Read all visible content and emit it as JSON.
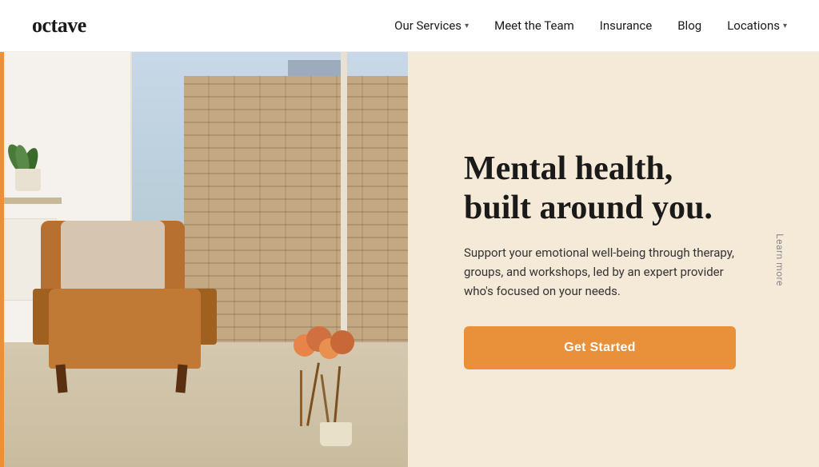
{
  "header": {
    "logo": "octave",
    "nav": {
      "services_label": "Our Services",
      "team_label": "Meet the Team",
      "insurance_label": "Insurance",
      "blog_label": "Blog",
      "locations_label": "Locations"
    }
  },
  "hero": {
    "headline_line1": "Mental health,",
    "headline_line2": "built around you.",
    "subtext": "Support your emotional well-being through therapy, groups, and workshops, led by an expert provider who's focused on your needs.",
    "cta_label": "Get Started",
    "learn_more_label": "Learn more"
  }
}
